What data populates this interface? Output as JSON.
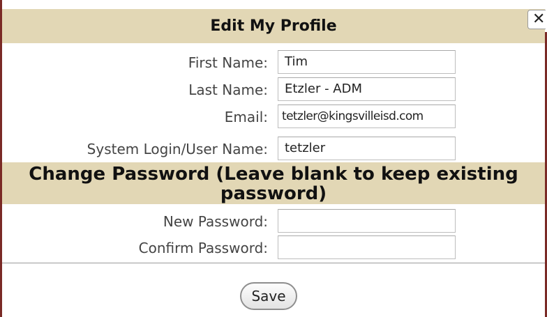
{
  "dialog": {
    "title": "Edit My Profile",
    "close_icon": "close-icon",
    "close_glyph": "✕"
  },
  "form": {
    "first_name": {
      "label": "First Name:",
      "value": "Tim"
    },
    "last_name": {
      "label": "Last Name:",
      "value": "Etzler - ADM"
    },
    "email": {
      "label": "Email:",
      "value": "tetzler@kingsvilleisd.com"
    },
    "username": {
      "label": "System Login/User Name:",
      "value": "tetzler"
    }
  },
  "password_section": {
    "heading": "Change Password (Leave blank to keep existing password)",
    "new_password": {
      "label": "New Password:",
      "value": ""
    },
    "confirm_password": {
      "label": "Confirm Password:",
      "value": ""
    }
  },
  "actions": {
    "save_label": "Save"
  },
  "colors": {
    "header_band": "#e2d7b5",
    "dialog_border": "#7a2a26"
  }
}
